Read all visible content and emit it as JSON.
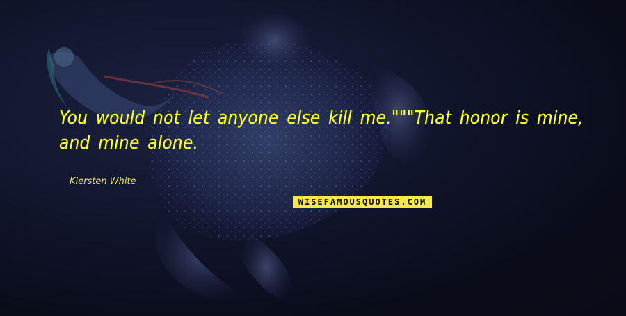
{
  "quote": {
    "text": "You would not let anyone else kill me.\"\"\"That honor is mine, and mine alone."
  },
  "author": {
    "name": "Kiersten White"
  },
  "brand": {
    "logo_text": "WISEFAMOUSQUOTES.COM"
  },
  "colors": {
    "background": "#0b0d1c",
    "quote_text": "#fbff3a",
    "logo_bg": "#f5e84a"
  },
  "background_image": {
    "icon": "mermaid-illustration-icon"
  }
}
